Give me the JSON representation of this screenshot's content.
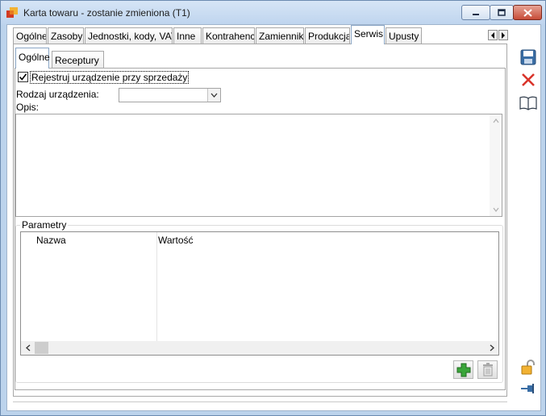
{
  "window": {
    "title": "Karta towaru - zostanie zmieniona (T1)",
    "controls": {
      "minimize": "minimize-icon",
      "maximize": "maximize-icon",
      "close": "close-icon"
    }
  },
  "tabs": [
    {
      "label": "Ogólne",
      "active": false
    },
    {
      "label": "Zasoby",
      "active": false
    },
    {
      "label": "Jednostki, kody, VAT",
      "active": false
    },
    {
      "label": "Inne",
      "active": false
    },
    {
      "label": "Kontrahenci",
      "active": false
    },
    {
      "label": "Zamienniki",
      "active": false
    },
    {
      "label": "Produkcja",
      "active": false
    },
    {
      "label": "Serwis",
      "active": true
    },
    {
      "label": "Upusty",
      "active": false
    }
  ],
  "subtabs": [
    {
      "label": "Ogólne",
      "active": true
    },
    {
      "label": "Receptury",
      "active": false
    }
  ],
  "serwis": {
    "register_checkbox_label": "Rejestruj urządzenie przy sprzedaży",
    "register_checked": true,
    "device_type_label": "Rodzaj urządzenia:",
    "device_type_value": "",
    "description_label": "Opis:",
    "description_value": ""
  },
  "parameters": {
    "group_title": "Parametry",
    "columns": [
      "Nazwa",
      "Wartość"
    ],
    "rows": []
  },
  "sidebar_icons": [
    "save-icon",
    "cancel-icon",
    "book-icon",
    "lock-icon",
    "pin-icon"
  ],
  "colors": {
    "accent": "#3a6ea5",
    "cancel": "#d9342b",
    "add": "#3aa63a"
  }
}
